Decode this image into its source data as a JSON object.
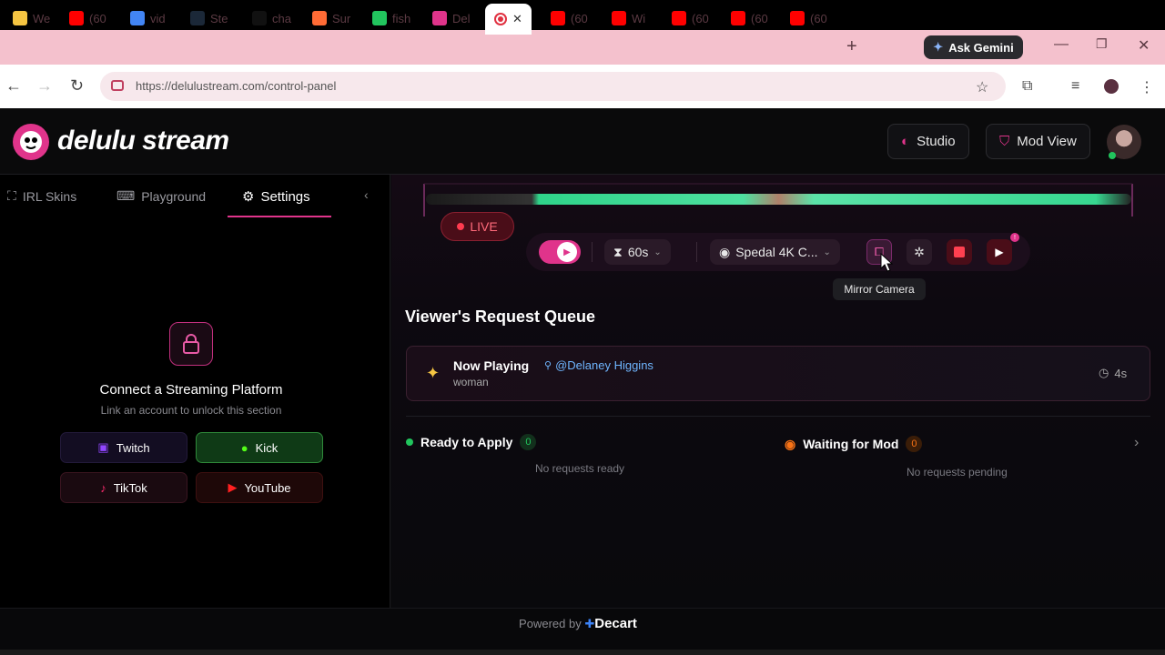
{
  "browser": {
    "tabs": [
      {
        "label": "We",
        "fav_color": "#f5c542"
      },
      {
        "label": "(60",
        "fav_color": "#ff0000"
      },
      {
        "label": "vid",
        "fav_color": "#4285f4"
      },
      {
        "label": "Ste",
        "fav_color": "#1b2838"
      },
      {
        "label": "cha",
        "fav_color": "#111111"
      },
      {
        "label": "Sur",
        "fav_color": "#ff6b35"
      },
      {
        "label": "fish",
        "fav_color": "#22c55e"
      },
      {
        "label": "Del",
        "fav_color": "#e0348b"
      },
      {
        "label": "(60",
        "fav_color": "#ff0000"
      },
      {
        "label": "Wi",
        "fav_color": "#ff0000"
      },
      {
        "label": "(60",
        "fav_color": "#ff0000"
      },
      {
        "label": "(60",
        "fav_color": "#ff0000"
      },
      {
        "label": "(60",
        "fav_color": "#ff0000"
      }
    ],
    "new_tab": "+",
    "gemini_label": "Ask Gemini",
    "url": "https://delulustream.com/control-panel"
  },
  "header": {
    "logo_text": "delulu stream",
    "studio_label": "Studio",
    "modview_label": "Mod View"
  },
  "left": {
    "tabs": [
      "IRL Skins",
      "Playground",
      "Settings"
    ],
    "connect_title": "Connect a Streaming Platform",
    "connect_sub": "Link an account to unlock this section",
    "platforms": [
      "Twitch",
      "Kick",
      "TikTok",
      "YouTube"
    ]
  },
  "stream": {
    "live_label": "LIVE",
    "duration": "60s",
    "camera": "Spedal 4K C...",
    "tooltip": "Mirror Camera"
  },
  "queue": {
    "title": "Viewer's Request Queue",
    "now_playing_label": "Now Playing",
    "now_playing_user": "@Delaney Higgins",
    "now_playing_prompt": "woman",
    "now_playing_time": "4s",
    "ready_label": "Ready to Apply",
    "ready_count": "0",
    "ready_empty": "No requests ready",
    "waiting_label": "Waiting for Mod",
    "waiting_count": "0",
    "waiting_empty": "No requests pending"
  },
  "footer": {
    "powered_by": "Powered by",
    "brand": "Decart"
  },
  "colors": {
    "accent": "#e0348b",
    "live": "#ff3b4f",
    "ready": "#21c55d",
    "waiting": "#f97316"
  }
}
